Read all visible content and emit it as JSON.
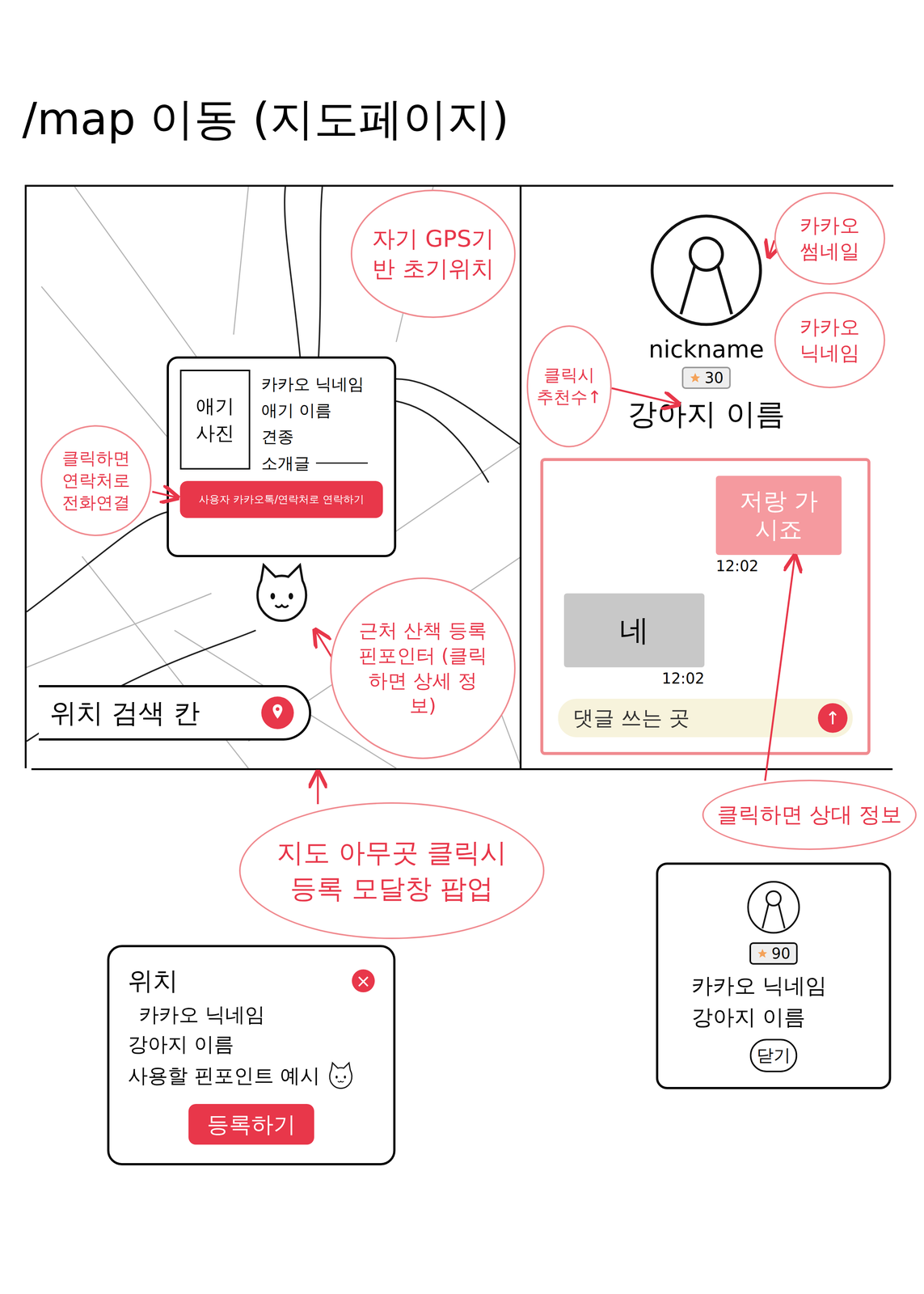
{
  "title": "/map 이동 (지도페이지)",
  "map_panel": {
    "card": {
      "photo": "애기 사진",
      "lines": [
        {
          "text": "카카오 닉네임",
          "kind": "plain"
        },
        {
          "text": "애기 이름",
          "kind": "plain"
        },
        {
          "text": "견종",
          "kind": "plain"
        },
        {
          "text": "소개글",
          "kind": "field"
        }
      ],
      "contact_button": "사용자 카카오톡/연락처로 연락하기"
    },
    "search": {
      "label": "위치 검색 칸"
    }
  },
  "chat_panel": {
    "nickname": "nickname",
    "likes": "30",
    "dog_name": "강아지 이름",
    "messages": [
      {
        "text": "저랑 가시죠",
        "time": "12:02",
        "mine": true
      },
      {
        "text": "네",
        "time": "12:02",
        "mine": false
      }
    ],
    "input": {
      "label": "댓글 쓰는 곳"
    },
    "send": "↑"
  },
  "register_modal": {
    "title": "위치",
    "close": "×",
    "lines": [
      {
        "text": "카카오 닉네임",
        "kind": "plain"
      },
      {
        "text": "강아지 이름",
        "kind": "plain"
      },
      {
        "text": "사용할 핀포인트 예시",
        "kind": "pin"
      }
    ],
    "button": "등록하기"
  },
  "profile_modal": {
    "likes": "90",
    "lines": [
      "카카오 닉네임",
      "강아지 이름"
    ],
    "button": "닫기"
  },
  "annotations": [
    {
      "text": "자기 GPS기반 초기위치"
    },
    {
      "text": "클릭하면 연락처로 전화연결"
    },
    {
      "text": "근처 산책 등록 핀포인터 (클릭하면 상세 정보)"
    },
    {
      "text": "카카오 썸네일"
    },
    {
      "text": "카카오 닉네임"
    },
    {
      "text": "클릭시 추천수↑"
    },
    {
      "text": "지도 아무곳 클릭시 등록 모달창 팝업"
    },
    {
      "text": "클릭하면 상대 정보"
    }
  ]
}
